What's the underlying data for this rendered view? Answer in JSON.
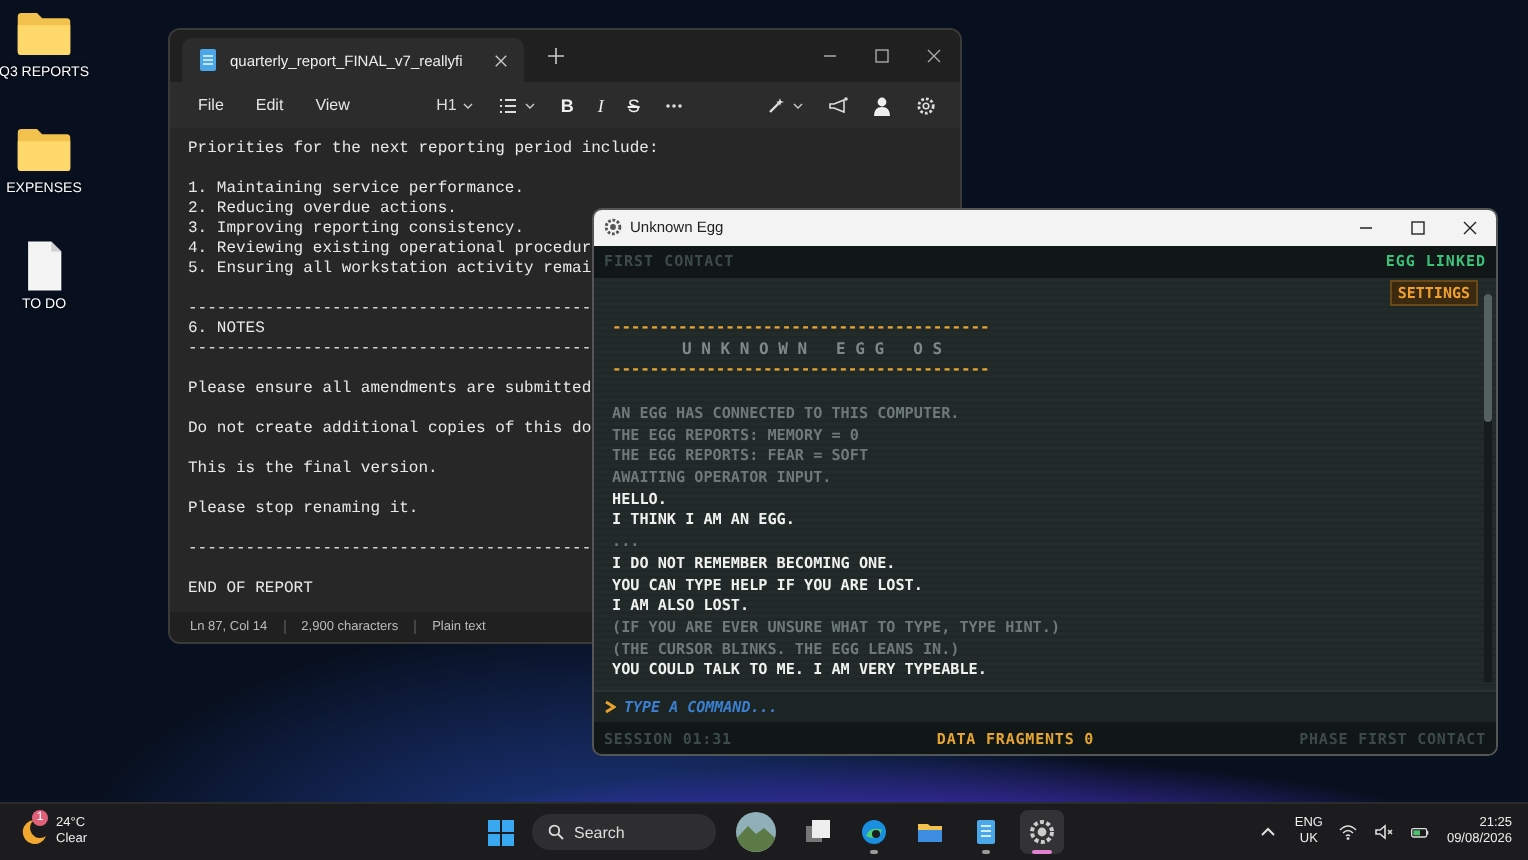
{
  "desktop_icons": [
    {
      "label": "Q3 REPORTS",
      "kind": "folder"
    },
    {
      "label": "EXPENSES",
      "kind": "folder"
    },
    {
      "label": "TO DO",
      "kind": "document"
    }
  ],
  "notepad": {
    "tab_title": "quarterly_report_FINAL_v7_reallyfi",
    "menu": [
      "File",
      "Edit",
      "View"
    ],
    "heading": "H1",
    "format_buttons": [
      "B",
      "I",
      "S"
    ],
    "blocks": [
      [
        "Priorities for the next reporting period include:"
      ],
      [
        "1. Maintaining service performance.",
        "2. Reducing overdue actions.",
        "3. Improving reporting consistency.",
        "4. Reviewing existing operational procedur",
        "5. Ensuring all workstation activity remai"
      ],
      [
        "------------------------------------------",
        "6. NOTES",
        "------------------------------------------"
      ],
      [
        "Please ensure all amendments are submitted"
      ],
      [
        "Do not create additional copies of this do"
      ],
      [
        "This is the final version."
      ],
      [
        "Please stop renaming it."
      ],
      [
        "------------------------------------------"
      ],
      [
        "END OF REPORT"
      ]
    ],
    "status": [
      "Ln 87, Col 14",
      "2,900 characters",
      "Plain text"
    ]
  },
  "egg": {
    "title": "Unknown Egg",
    "header_left": "FIRST CONTACT",
    "header_right": "EGG LINKED",
    "settings": "SETTINGS",
    "banner_rule": "----------------------------------------",
    "banner_title": "U N K N O W N   E G G   O S",
    "log": [
      {
        "text": "AN EGG HAS CONNECTED TO THIS COMPUTER.",
        "kind": "system"
      },
      {
        "text": "THE EGG REPORTS: MEMORY = 0",
        "kind": "system"
      },
      {
        "text": "THE EGG REPORTS: FEAR = SOFT",
        "kind": "system"
      },
      {
        "text": "AWAITING OPERATOR INPUT.",
        "kind": "system"
      },
      {
        "text": "HELLO.",
        "kind": "egg"
      },
      {
        "text": "I THINK I AM AN EGG.",
        "kind": "egg"
      },
      {
        "text": "...",
        "kind": "system"
      },
      {
        "text": "I DO NOT REMEMBER BECOMING ONE.",
        "kind": "egg"
      },
      {
        "text": "YOU CAN TYPE HELP IF YOU ARE LOST.",
        "kind": "egg"
      },
      {
        "text": "I AM ALSO LOST.",
        "kind": "egg"
      },
      {
        "text": "(IF YOU ARE EVER UNSURE WHAT TO TYPE, TYPE HINT.)",
        "kind": "system"
      },
      {
        "text": "(THE CURSOR BLINKS. THE EGG LEANS IN.)",
        "kind": "system"
      },
      {
        "text": "YOU COULD TALK TO ME. I AM VERY TYPEABLE.",
        "kind": "egg"
      }
    ],
    "input_placeholder": "TYPE A COMMAND...",
    "footer": {
      "session": "SESSION 01:31",
      "fragments": "DATA FRAGMENTS 0",
      "phase": "PHASE FIRST CONTACT"
    }
  },
  "taskbar": {
    "weather": {
      "badge": "1",
      "temperature": "24°C",
      "condition": "Clear"
    },
    "search_placeholder": "Search",
    "apps": [
      {
        "kind": "widget",
        "running": false,
        "active": false
      },
      {
        "kind": "task-view",
        "running": false,
        "active": false
      },
      {
        "kind": "browser",
        "running": true,
        "active": false
      },
      {
        "kind": "files",
        "running": false,
        "active": false
      },
      {
        "kind": "notepad",
        "running": true,
        "active": false
      },
      {
        "kind": "egg",
        "running": true,
        "active": true
      }
    ],
    "language": "ENG",
    "region": "UK",
    "time": "21:25",
    "date": "09/08/2026"
  }
}
